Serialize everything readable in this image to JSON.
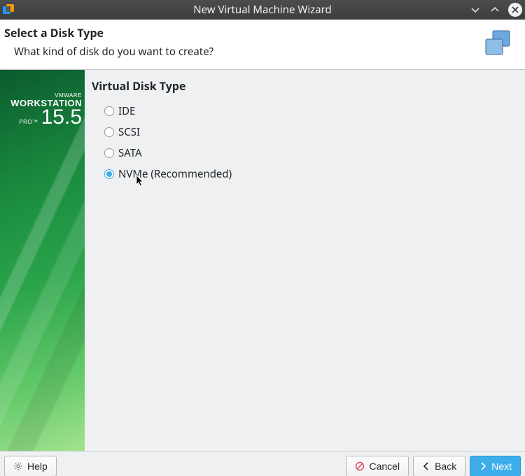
{
  "window": {
    "title": "New Virtual Machine Wizard"
  },
  "header": {
    "heading": "Select a Disk Type",
    "subtitle": "What kind of disk do you want to create?"
  },
  "sidebar_brand": {
    "line1": "VMWARE",
    "line2": "WORKSTATION",
    "pro": "PRO™",
    "version": "15.5"
  },
  "form": {
    "group_title": "Virtual Disk Type",
    "options": [
      {
        "label": "IDE",
        "selected": false
      },
      {
        "label": "SCSI",
        "selected": false
      },
      {
        "label": "SATA",
        "selected": false
      },
      {
        "label": "NVMe (Recommended)",
        "selected": true
      }
    ]
  },
  "buttons": {
    "help": "Help",
    "cancel": "Cancel",
    "back": "Back",
    "next": "Next"
  }
}
